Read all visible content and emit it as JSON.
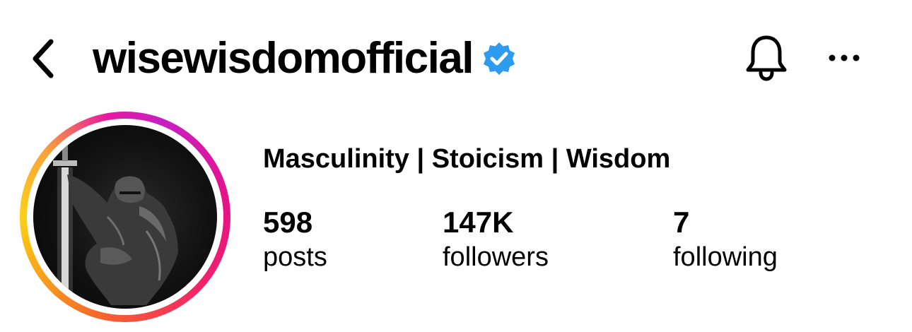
{
  "header": {
    "username": "wisewisdomofficial",
    "verified": true,
    "verified_color": "#2d9bf0",
    "icons": {
      "back": "chevron-left-icon",
      "notifications": "bell-icon",
      "more": "ellipsis-icon"
    }
  },
  "profile": {
    "bio": "Masculinity | Stoicism | Wisdom",
    "has_story_ring": true,
    "avatar_description_icon": "avatar-image"
  },
  "stats": {
    "posts": {
      "value": "598",
      "label": "posts"
    },
    "followers": {
      "value": "147K",
      "label": "followers"
    },
    "following": {
      "value": "7",
      "label": "following"
    }
  }
}
